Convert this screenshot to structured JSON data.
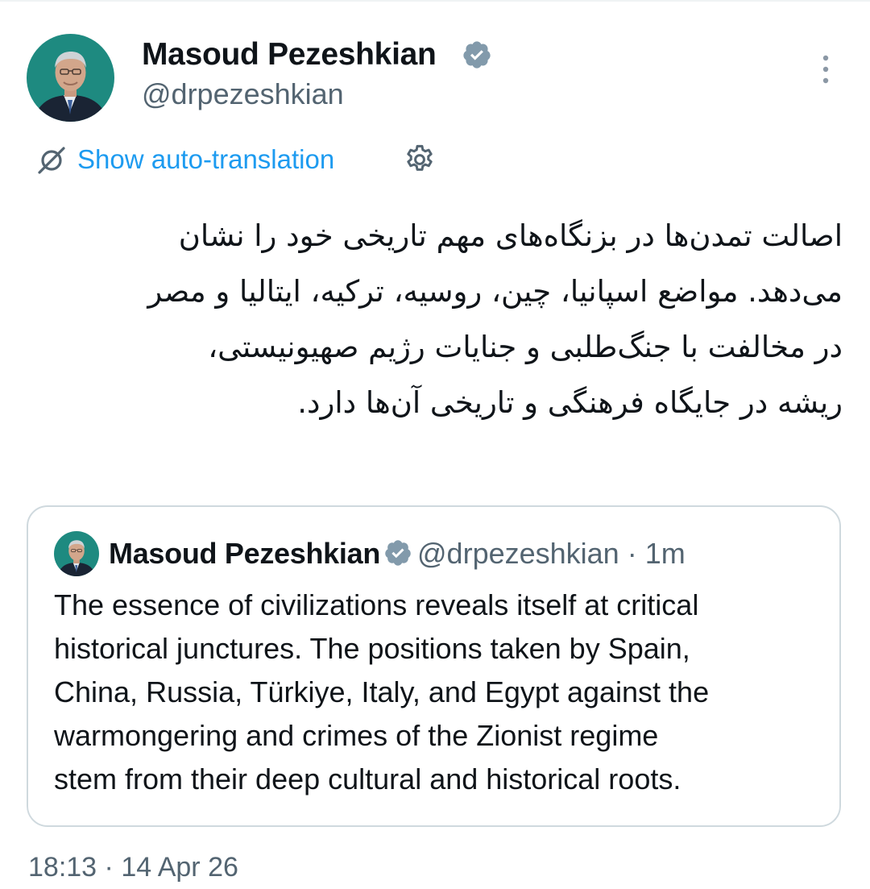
{
  "tweet": {
    "author": {
      "name": "Masoud Pezeshkian",
      "handle": "@drpezeshkian",
      "verified_color": "#829aab"
    },
    "translation": {
      "link_label": "Show auto-translation"
    },
    "text_lines": [
      "اصالت تمدن‌ها در بزنگاه‌های مهم تاریخی خود را نشان",
      "می‌دهد. مواضع اسپانیا، چین، روسیه، ترکیه، ایتالیا و مصر",
      "در مخالفت با جنگ‌طلبی و جنایات رژیم صهیونیستی،",
      "ریشه در جایگاه فرهنگی و تاریخی آن‌ها دارد."
    ],
    "quoted": {
      "name": "Masoud Pezeshkian",
      "handle": "@drpezeshkian",
      "separator": "·",
      "relative_time": "1m",
      "text_lines": [
        "The essence of civilizations reveals itself at critical",
        "historical junctures. The positions taken by Spain,",
        "China, Russia, Türkiye, Italy, and Egypt against the",
        "warmongering and crimes of the Zionist regime",
        "stem from their deep cultural and historical roots."
      ]
    },
    "timestamp": {
      "time": "18:13",
      "separator": "·",
      "date": "14 Apr 26"
    }
  },
  "colors": {
    "link": "#1d9bf0",
    "secondary_text": "#536471",
    "primary_text": "#0f1419",
    "border": "#cfd9de",
    "avatar_bg": "#1e8a80"
  },
  "icons": {
    "verified": "verified-badge-icon",
    "more": "more-vertical-icon",
    "translate": "no-translate-icon",
    "settings": "gear-icon"
  }
}
